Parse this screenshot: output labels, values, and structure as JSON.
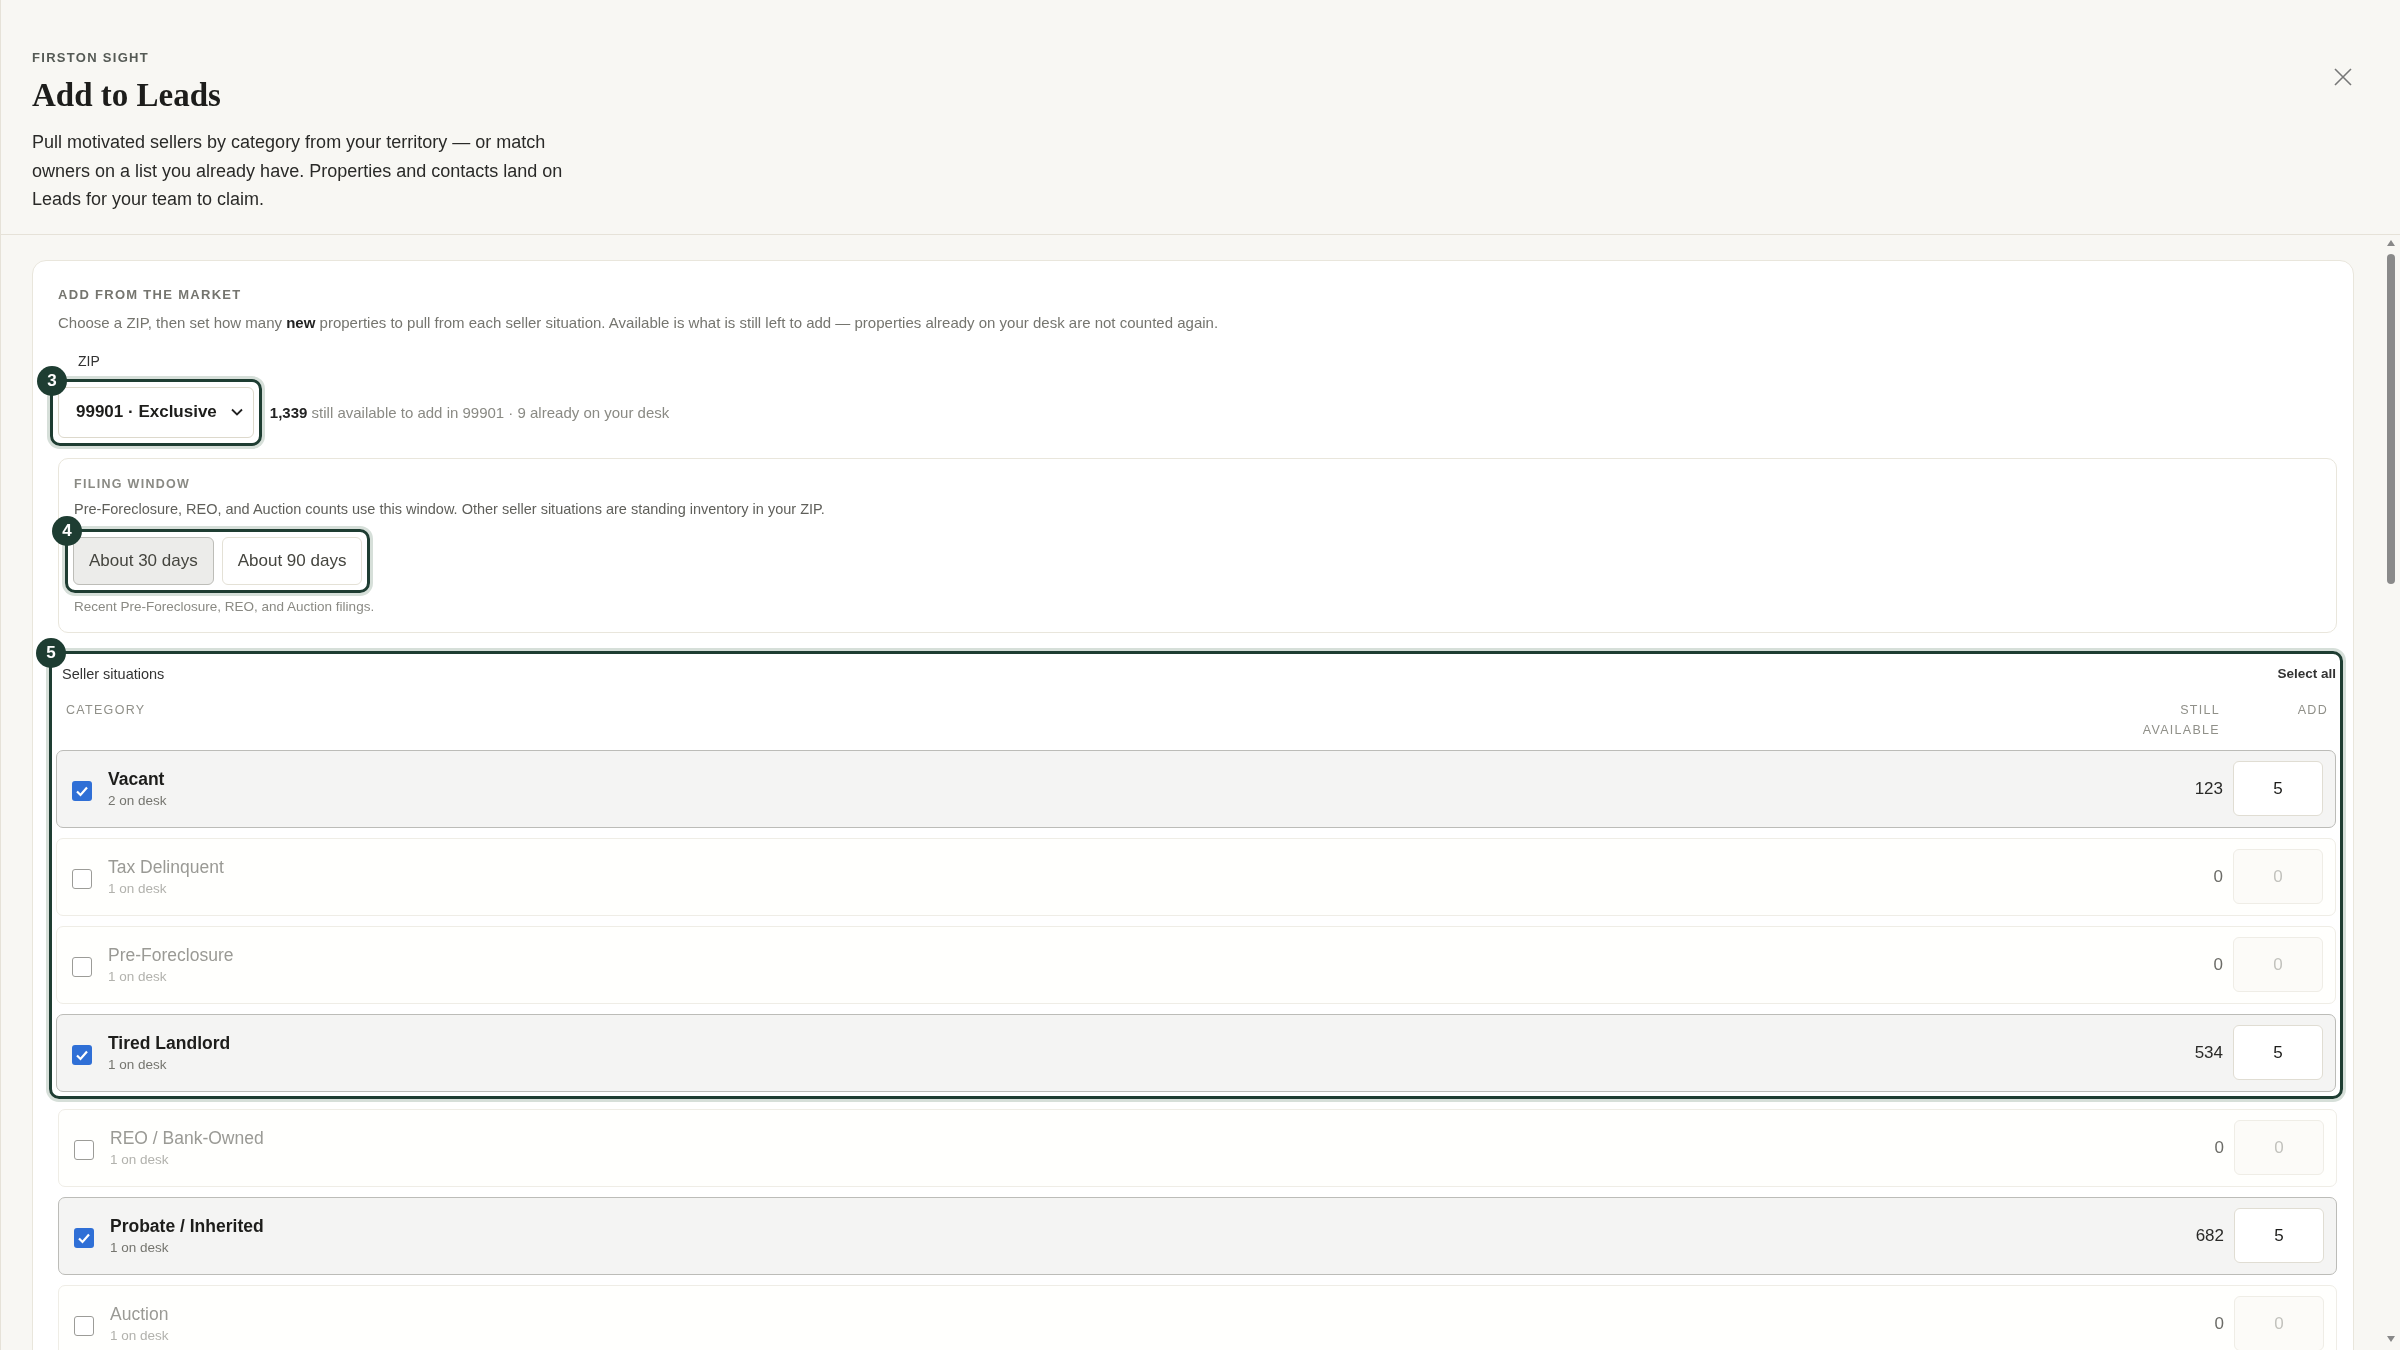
{
  "header": {
    "brand": "FIRSTON SIGHT",
    "title": "Add to Leads",
    "intro": "Pull motivated sellers by category from your territory — or match owners on a list you already have. Properties and contacts land on Leads for your team to claim."
  },
  "market": {
    "heading": "ADD FROM THE MARKET",
    "description": "Choose a ZIP, then set how many **new** properties to pull from each seller situation. Available is what is still left to add — properties already on your desk are not counted again.",
    "zip": {
      "step": "3",
      "label": "ZIP",
      "value": "99901 · Exclusive",
      "count": "1,339",
      "availability": "still available to add in 99901 · 9 already on your desk"
    },
    "filing_window": {
      "step": "4",
      "heading": "FILING WINDOW",
      "description": "Pre-Foreclosure, REO, and Auction counts use this window. Other seller situations are standing inventory in your ZIP.",
      "hint": "Recent Pre-Foreclosure, REO, and Auction filings.",
      "options": [
        {
          "label": "About 30 days",
          "selected": true
        },
        {
          "label": "About 90 days",
          "selected": false
        }
      ]
    },
    "sellers": {
      "step": "5",
      "title": "Seller situations",
      "select_all": "Select all",
      "columns": [
        "CATEGORY",
        "STILL AVAILABLE",
        "ADD"
      ],
      "rows": [
        {
          "name": "Vacant",
          "on_desk": "2 on desk",
          "available": "123",
          "add": "5",
          "checked": true
        },
        {
          "name": "Tax Delinquent",
          "on_desk": "1 on desk",
          "available": "0",
          "add": "0",
          "checked": false
        },
        {
          "name": "Pre-Foreclosure",
          "on_desk": "1 on desk",
          "available": "0",
          "add": "0",
          "checked": false
        },
        {
          "name": "Tired Landlord",
          "on_desk": "1 on desk",
          "available": "534",
          "add": "5",
          "checked": true
        },
        {
          "name": "REO / Bank-Owned",
          "on_desk": "1 on desk",
          "available": "0",
          "add": "0",
          "checked": false
        },
        {
          "name": "Probate / Inherited",
          "on_desk": "1 on desk",
          "available": "682",
          "add": "5",
          "checked": true
        },
        {
          "name": "Auction",
          "on_desk": "1 on desk",
          "available": "0",
          "add": "0",
          "checked": false
        }
      ]
    }
  }
}
